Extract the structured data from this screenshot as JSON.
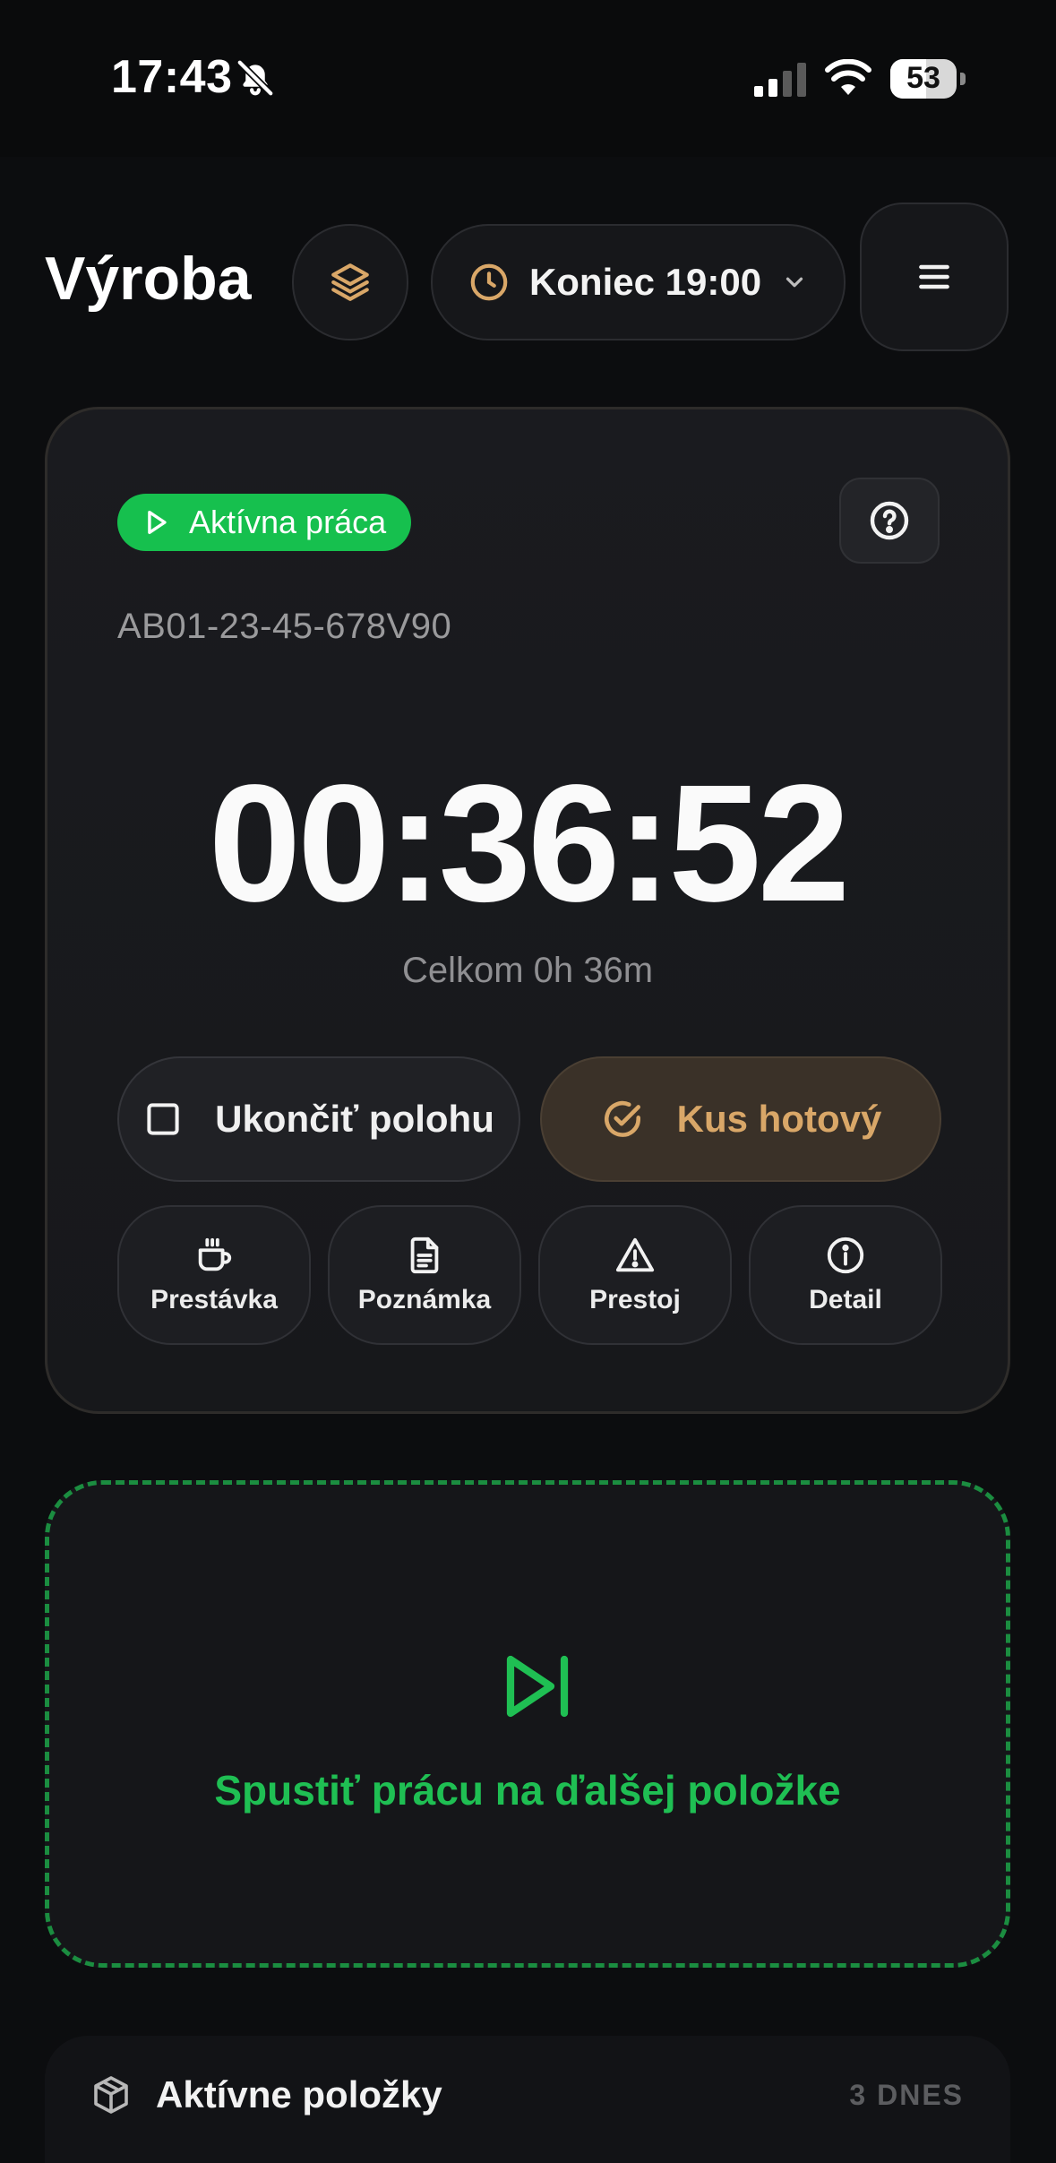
{
  "status_bar": {
    "time": "17:43",
    "battery": "53",
    "icons": [
      "bell-slash-icon",
      "signal-icon",
      "wifi-icon",
      "battery-icon"
    ]
  },
  "header": {
    "title": "Výroba",
    "layers_icon": "layers-icon",
    "shift_label": "Koniec 19:00",
    "shift_icons": [
      "clock-icon",
      "chevron-down-icon"
    ],
    "menu_icon": "hamburger-menu-icon"
  },
  "work_card": {
    "status": "Aktívna práca",
    "code": "AB01-23-45-678V90",
    "timer": "00:36:52",
    "total": "Celkom 0h 36m",
    "end_position": "Ukončiť polohu",
    "piece_done": "Kus hotový",
    "actions": [
      {
        "label": "Prestávka",
        "icon": "coffee-cup-icon"
      },
      {
        "label": "Poznámka",
        "icon": "document-icon"
      },
      {
        "label": "Prestoj",
        "icon": "warning-triangle-icon"
      },
      {
        "label": "Detail",
        "icon": "info-circle-icon"
      }
    ]
  },
  "next": {
    "label": "Spustiť prácu na ďalšej položke",
    "icon": "play-skip-icon"
  },
  "items": {
    "title": "Aktívne položky",
    "count": "3 DNES",
    "icon": "box-icon"
  },
  "colors": {
    "background": "#0c0d0f",
    "accent_green": "#16c04e",
    "accent_gold": "#d9a768"
  }
}
